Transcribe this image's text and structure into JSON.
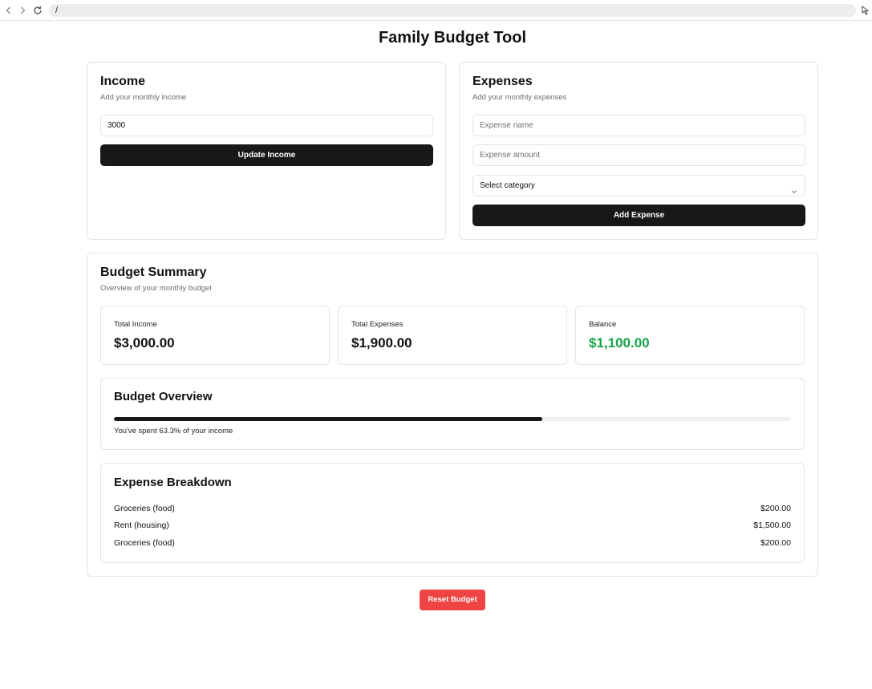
{
  "browser": {
    "url": "/"
  },
  "page_title": "Family Budget Tool",
  "income": {
    "title": "Income",
    "description": "Add your monthly income",
    "input_value": "3000",
    "button_label": "Update Income"
  },
  "expenses": {
    "title": "Expenses",
    "description": "Add your monthly expenses",
    "name_placeholder": "Expense name",
    "amount_placeholder": "Expense amount",
    "category_selected": "Select category",
    "button_label": "Add Expense"
  },
  "summary": {
    "title": "Budget Summary",
    "description": "Overview of your monthly budget",
    "stats": [
      {
        "label": "Total Income",
        "value": "$3,000.00"
      },
      {
        "label": "Total Expenses",
        "value": "$1,900.00"
      },
      {
        "label": "Balance",
        "value": "$1,100.00"
      }
    ],
    "balance_color": "#16a34a",
    "overview": {
      "title": "Budget Overview",
      "spent_percent": 63.3,
      "spent_text": "You've spent 63.3% of your income"
    },
    "breakdown": {
      "title": "Expense Breakdown",
      "items": [
        {
          "label": "Groceries (food)",
          "amount": "$200.00"
        },
        {
          "label": "Rent (housing)",
          "amount": "$1,500.00"
        },
        {
          "label": "Groceries (food)",
          "amount": "$200.00"
        }
      ]
    }
  },
  "reset_button_label": "Reset Budget",
  "colors": {
    "primary_button": "#18181b",
    "reset_button": "#ef4444",
    "positive": "#16a34a"
  },
  "icons": {
    "back": "chevron-left-icon",
    "forward": "chevron-right-icon",
    "reload": "reload-icon",
    "select": "chevron-down-icon"
  }
}
